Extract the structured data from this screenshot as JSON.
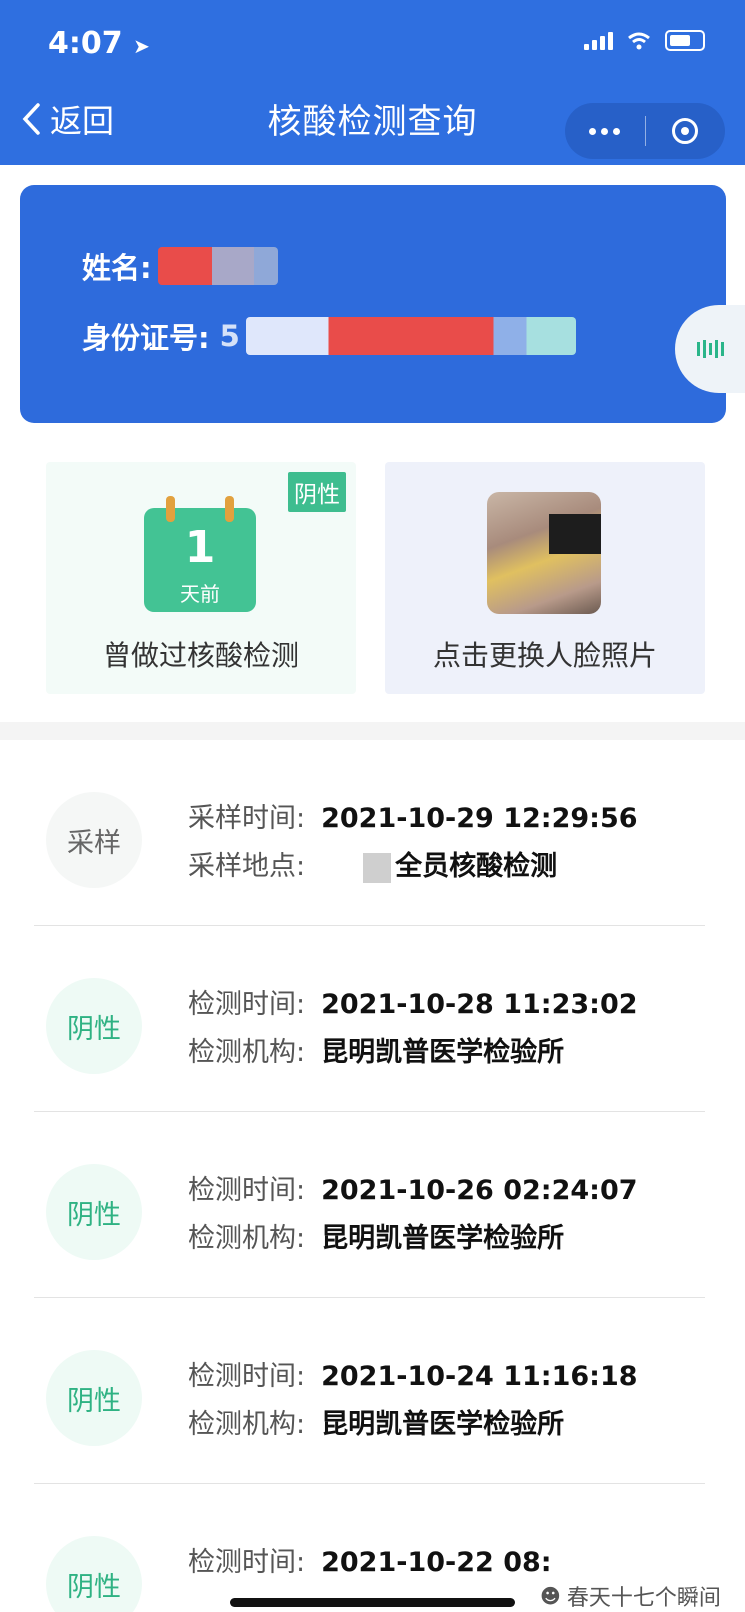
{
  "status_bar": {
    "time": "4:07"
  },
  "nav": {
    "back_label": "返回",
    "title": "核酸检测查询"
  },
  "colors": {
    "primary_blue": "#2f6fe0",
    "negative_green": "#3ebd8f",
    "calendar_ring": "#e2a13e"
  },
  "id_card": {
    "name_label": "姓名:",
    "id_label": "身份证号:",
    "id_visible_prefix": "5"
  },
  "summary": {
    "badge": "阴性",
    "calendar_number": "1",
    "calendar_sub": "天前",
    "left_caption": "曾做过核酸检测",
    "right_caption": "点击更换人脸照片"
  },
  "records": [
    {
      "status": "采样",
      "label1": "采样时间:",
      "value1": "2021-10-29 12:29:56",
      "label2": "采样地点:",
      "value2": "全员核酸检测"
    },
    {
      "status": "阴性",
      "label1": "检测时间:",
      "value1": "2021-10-28 11:23:02",
      "label2": "检测机构:",
      "value2": "昆明凯普医学检验所"
    },
    {
      "status": "阴性",
      "label1": "检测时间:",
      "value1": "2021-10-26 02:24:07",
      "label2": "检测机构:",
      "value2": "昆明凯普医学检验所"
    },
    {
      "status": "阴性",
      "label1": "检测时间:",
      "value1": "2021-10-24 11:16:18",
      "label2": "检测机构:",
      "value2": "昆明凯普医学检验所"
    },
    {
      "status": "阴性",
      "label1": "检测时间:",
      "value1": "2021-10-22 08:",
      "label2": "",
      "value2": ""
    }
  ],
  "watermark": "春天十七个瞬间",
  "icons": [
    "location-arrow-icon",
    "signal-icon",
    "wifi-icon",
    "battery-icon",
    "back-chevron-icon",
    "more-dots-icon",
    "close-target-icon",
    "barcode-icon",
    "calendar-icon",
    "face-photo",
    "wechat-icon"
  ]
}
